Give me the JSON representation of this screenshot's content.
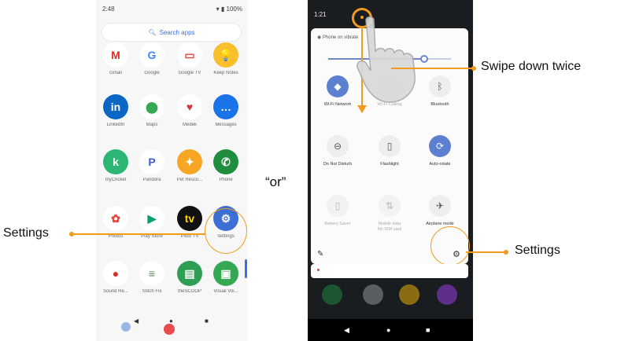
{
  "left_phone": {
    "status_time": "2:48",
    "status_battery": "100%",
    "search_placeholder": "Search apps",
    "apps": [
      {
        "label": "Gmail",
        "glyph": "M",
        "color": "#ffffff",
        "fg": "#d93025"
      },
      {
        "label": "Google",
        "glyph": "G",
        "color": "#ffffff",
        "fg": "#4285f4"
      },
      {
        "label": "Google TV",
        "glyph": "▭",
        "color": "#ffffff",
        "fg": "#e8463a"
      },
      {
        "label": "Keep Notes",
        "glyph": "💡",
        "color": "#f9bf2d",
        "fg": "#ffffff"
      },
      {
        "label": "LinkedIn",
        "glyph": "in",
        "color": "#0a66c2",
        "fg": "#ffffff"
      },
      {
        "label": "Maps",
        "glyph": "⬤",
        "color": "#ffffff",
        "fg": "#34a853"
      },
      {
        "label": "Medek",
        "glyph": "♥",
        "color": "#ffffff",
        "fg": "#d9343a"
      },
      {
        "label": "Messages",
        "glyph": "…",
        "color": "#1a73e8",
        "fg": "#ffffff"
      },
      {
        "label": "myCricket",
        "glyph": "k",
        "color": "#2bb673",
        "fg": "#ffffff"
      },
      {
        "label": "Pandora",
        "glyph": "P",
        "color": "#ffffff",
        "fg": "#3b5bdb"
      },
      {
        "label": "Pet Rescu...",
        "glyph": "✦",
        "color": "#f6a623",
        "fg": "#ffffff"
      },
      {
        "label": "Phone",
        "glyph": "✆",
        "color": "#1e8e3e",
        "fg": "#ffffff"
      },
      {
        "label": "Photos",
        "glyph": "✿",
        "color": "#ffffff",
        "fg": "#ea4335"
      },
      {
        "label": "Play Store",
        "glyph": "▶",
        "color": "#ffffff",
        "fg": "#00a173"
      },
      {
        "label": "Pluto TV",
        "glyph": "tv",
        "color": "#111111",
        "fg": "#ffd400"
      },
      {
        "label": "Settings",
        "glyph": "⚙",
        "color": "#3c6fd6",
        "fg": "#ffffff"
      },
      {
        "label": "Sound Re...",
        "glyph": "●",
        "color": "#ffffff",
        "fg": "#d93025"
      },
      {
        "label": "Stitch Fix",
        "glyph": "≡",
        "color": "#ffffff",
        "fg": "#5b8f5b"
      },
      {
        "label": "theSCOOP",
        "glyph": "▤",
        "color": "#2e9e52",
        "fg": "#ffffff"
      },
      {
        "label": "Visual Voi...",
        "glyph": "▣",
        "color": "#34a853",
        "fg": "#ffffff"
      }
    ]
  },
  "or_text": "“or”",
  "right_phone": {
    "status_time": "1:21",
    "panel_header": "Phone on vibrate",
    "brightness_level": 0.78,
    "tiles": [
      {
        "label": "Wi-Fi Network",
        "glyph": "◆",
        "state": "on"
      },
      {
        "label": "Wi-Fi Calling",
        "glyph": "≋",
        "state": "dim"
      },
      {
        "label": "Bluetooth",
        "glyph": "ᛒ",
        "state": "off"
      },
      {
        "label": "Do Not Disturb",
        "glyph": "⊖",
        "state": "off"
      },
      {
        "label": "Flashlight",
        "glyph": "▯",
        "state": "off"
      },
      {
        "label": "Auto-rotate",
        "glyph": "⟳",
        "state": "on"
      },
      {
        "label": "Battery Saver",
        "glyph": "▯",
        "state": "dim"
      },
      {
        "label": "Mobile data\nNo SIM card",
        "glyph": "⇅",
        "state": "dim"
      },
      {
        "label": "Airplane mode",
        "glyph": "✈",
        "state": "off"
      }
    ]
  },
  "callouts": {
    "left_settings": "Settings",
    "right_settings": "Settings",
    "swipe": "Swipe down twice",
    "accent_color": "#f39a1e"
  }
}
